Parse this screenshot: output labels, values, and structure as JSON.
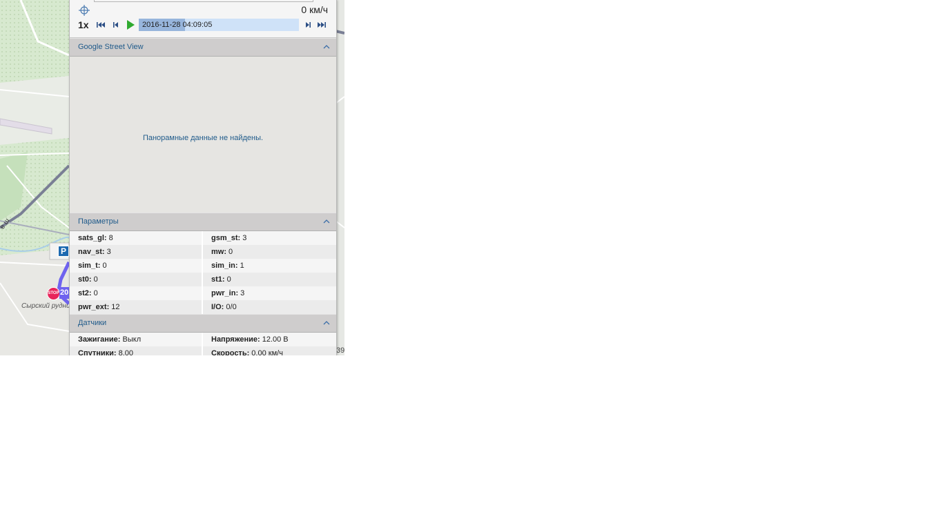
{
  "player": {
    "speed_readout": "0 км/ч",
    "speed_multiplier": "1x",
    "timeline_timestamp": "2016-11-28 04:09:05",
    "timeline_progress": 0.29
  },
  "street_view": {
    "title": "Google Street View",
    "message": "Панорамные данные не найдены."
  },
  "params": {
    "title": "Параметры",
    "rows": [
      {
        "k1": "sats_gl:",
        "v1": " 8",
        "k2": "gsm_st:",
        "v2": " 3"
      },
      {
        "k1": "nav_st:",
        "v1": " 3",
        "k2": "mw:",
        "v2": " 0"
      },
      {
        "k1": "sim_t:",
        "v1": " 0",
        "k2": "sim_in:",
        "v2": " 1"
      },
      {
        "k1": "st0:",
        "v1": " 0",
        "k2": "st1:",
        "v2": " 0"
      },
      {
        "k1": "st2:",
        "v1": " 0",
        "k2": "pwr_in:",
        "v2": " 3"
      },
      {
        "k1": "pwr_ext:",
        "v1": " 12",
        "k2": "I/O:",
        "v2": " 0/0"
      }
    ]
  },
  "sensors": {
    "title": "Датчики",
    "rows": [
      {
        "k1": "Зажигание:",
        "v1": " Выкл",
        "k2": "Напряжение:",
        "v2": " 12.00 В"
      },
      {
        "k1": "Спутники:",
        "v1": " 8.00",
        "k2": "Скорость:",
        "v2": " 0.00 км/ч"
      }
    ]
  },
  "map": {
    "parking_label": "P",
    "stop_label": "STOP",
    "route_number": "20",
    "place_label": "Сырский рудник",
    "road_label": "е ш",
    "edge_fragment": "39"
  },
  "colors": {
    "map_green": "#cfe6c6",
    "map_road": "#ffffff",
    "map_highway": "#7a7f95",
    "route": "#6f63ef",
    "stop": "#e8245a",
    "parking": "#1c69b0",
    "accent_text": "#1f5a8a"
  }
}
